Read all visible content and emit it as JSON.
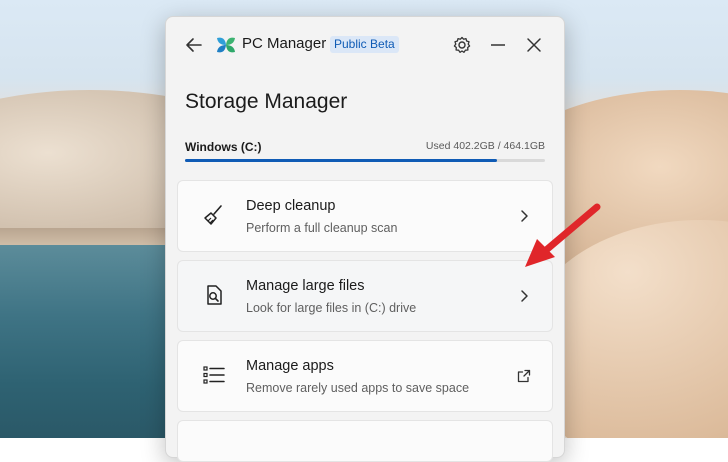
{
  "window": {
    "app_name": "PC Manager",
    "badge": "Public Beta",
    "page_title": "Storage Manager"
  },
  "drive": {
    "label": "Windows (C:)",
    "usage_text": "Used 402.2GB / 464.1GB",
    "used_fraction": 0.8666
  },
  "cards": [
    {
      "title": "Deep cleanup",
      "subtitle": "Perform a full cleanup scan",
      "icon": "broom-icon",
      "action": "chevron-right-icon"
    },
    {
      "title": "Manage large files",
      "subtitle": "Look for large files in (C:) drive",
      "icon": "file-search-icon",
      "action": "chevron-right-icon"
    },
    {
      "title": "Manage apps",
      "subtitle": "Remove rarely used apps to save space",
      "icon": "list-icon",
      "action": "external-link-icon"
    }
  ],
  "colors": {
    "accent": "#0f5bb5",
    "annotation_arrow": "#e0262a"
  }
}
